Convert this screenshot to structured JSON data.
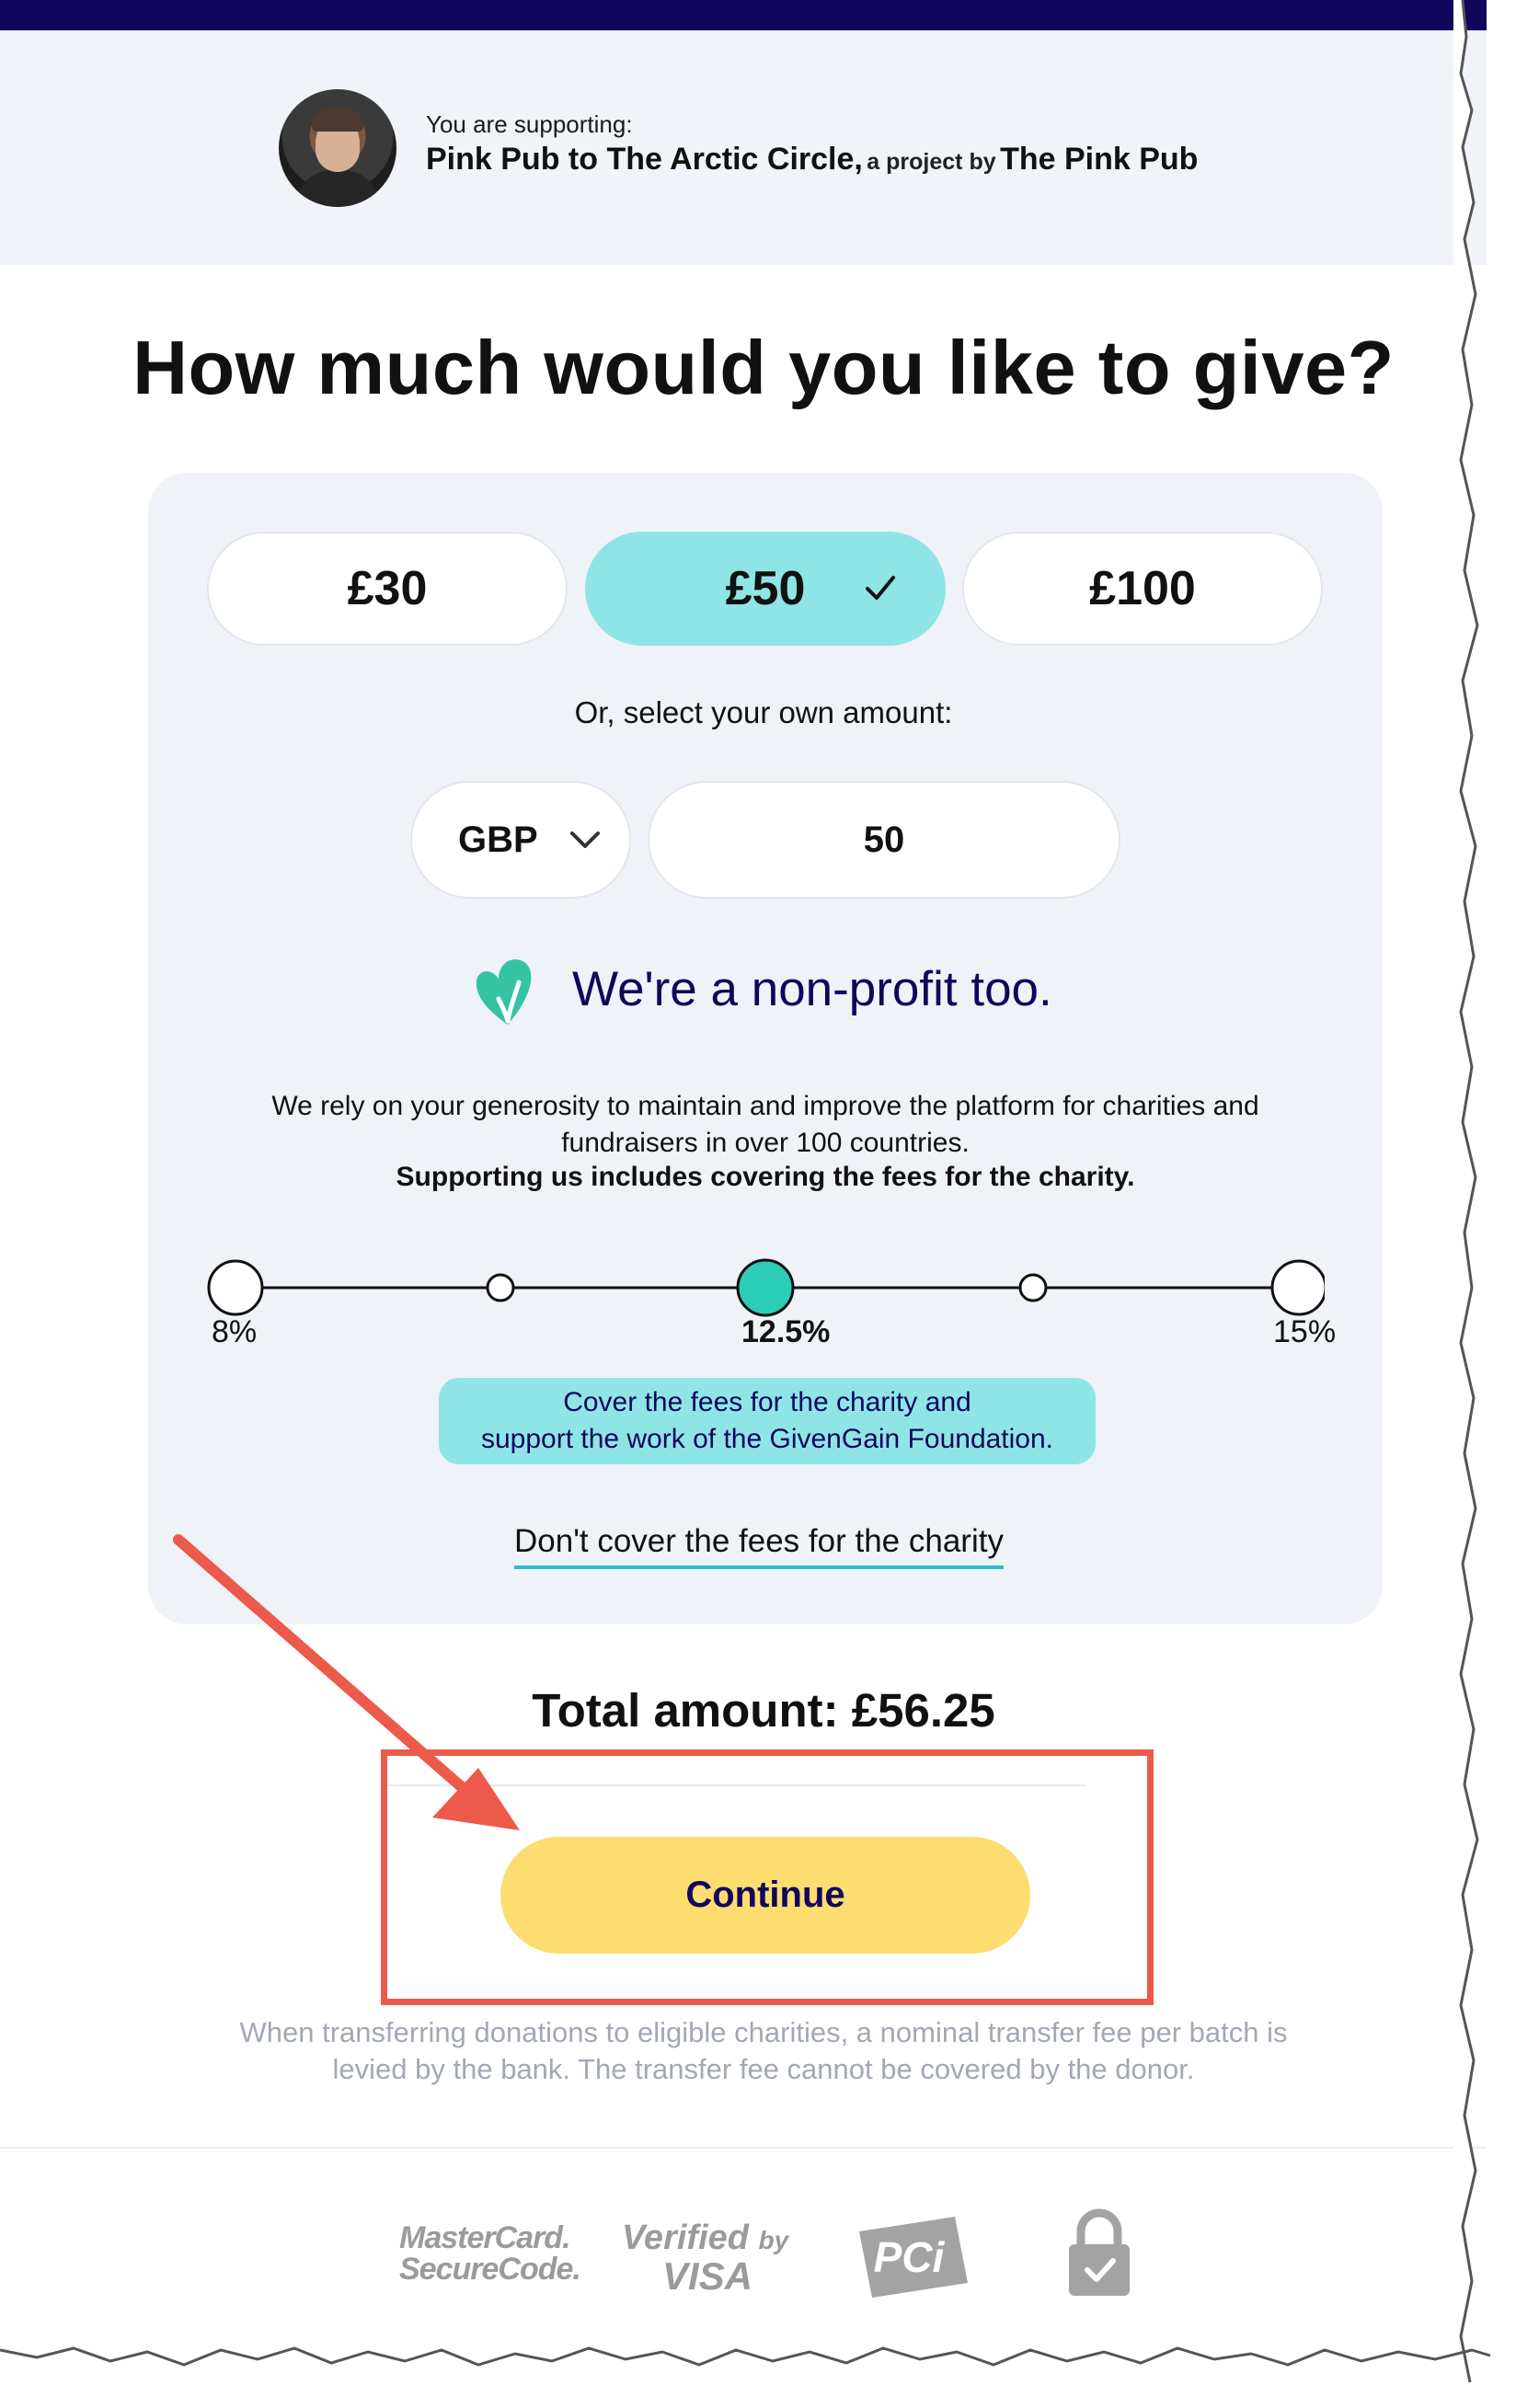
{
  "header": {
    "supporting_label": "You are supporting:",
    "project_name": "Pink Pub to The Arctic Circle,",
    "project_by": "a project by",
    "owner_name": "The Pink Pub"
  },
  "heading": "How much would you like to give?",
  "amounts": [
    {
      "label": "£30",
      "selected": false
    },
    {
      "label": "£50",
      "selected": true
    },
    {
      "label": "£100",
      "selected": false
    }
  ],
  "own_amount_label": "Or, select your own amount:",
  "currency": {
    "selected": "GBP"
  },
  "amount_input": {
    "value": "50"
  },
  "nonprofit": {
    "title": "We're a non-profit too.",
    "description": "We rely on your generosity to maintain and improve the platform for charities and fundraisers in over 100 countries.",
    "bold_note": "Supporting us includes covering the fees for the charity."
  },
  "fee_slider": {
    "labels": {
      "min": "8%",
      "selected": "12.5%",
      "max": "15%"
    },
    "steps": 5,
    "selected_index": 2,
    "tooltip_line1": "Cover the fees for the charity and",
    "tooltip_line2": "support the work of the GivenGain Foundation.",
    "opt_out_link": "Don't cover the fees for the charity"
  },
  "total": "Total amount: £56.25",
  "continue_label": "Continue",
  "disclaimer": "When transferring donations to eligible charities, a nominal transfer fee per batch is levied by the bank. The transfer fee cannot be covered by the donor.",
  "trust_logos": {
    "mastercard_line1": "MasterCard.",
    "mastercard_line2": "SecureCode.",
    "visa_line1": "Verified",
    "visa_by": "by",
    "visa_line2": "VISA",
    "pci": "PCi"
  },
  "colors": {
    "navy": "#10065c",
    "teal": "#8fe5e6",
    "teal_dark": "#29c9b8",
    "yellow": "#fddd70",
    "annotation_red": "#ec5a4b"
  },
  "icons": [
    "check-icon",
    "chevron-down-icon",
    "heart-icon",
    "lock-icon"
  ]
}
